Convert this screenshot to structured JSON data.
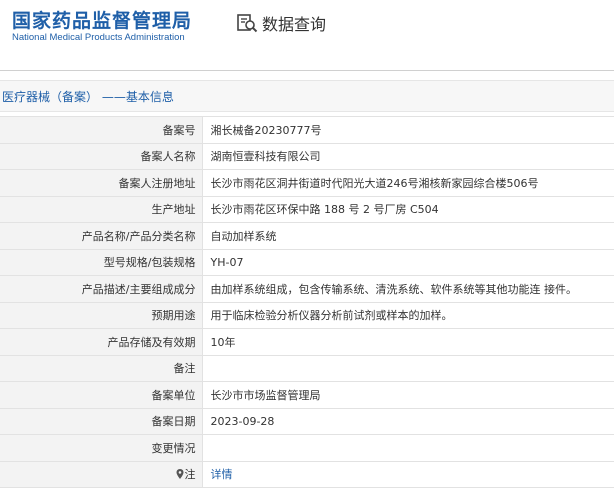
{
  "header": {
    "logo_cn": "国家药品监督管理局",
    "logo_en": "National Medical Products Administration",
    "query_label": "数据查询"
  },
  "breadcrumb": {
    "text": "医疗器械（备案） ——基本信息"
  },
  "rows": [
    {
      "label": "备案号",
      "value": "湘长械备20230777号"
    },
    {
      "label": "备案人名称",
      "value": "湖南恒壹科技有限公司"
    },
    {
      "label": "备案人注册地址",
      "value": "长沙市雨花区洞井街道时代阳光大道246号湘核新家园综合楼506号"
    },
    {
      "label": "生产地址",
      "value": "长沙市雨花区环保中路 188 号 2 号厂房 C504"
    },
    {
      "label": "产品名称/产品分类名称",
      "value": "自动加样系统"
    },
    {
      "label": "型号规格/包装规格",
      "value": "YH-07"
    },
    {
      "label": "产品描述/主要组成成分",
      "value": "由加样系统组成，包含传输系统、清洗系统、软件系统等其他功能连 接件。"
    },
    {
      "label": "预期用途",
      "value": "用于临床检验分析仪器分析前试剂或样本的加样。"
    },
    {
      "label": "产品存储及有效期",
      "value": "10年"
    },
    {
      "label": "备注",
      "value": ""
    },
    {
      "label": "备案单位",
      "value": "长沙市市场监督管理局"
    },
    {
      "label": "备案日期",
      "value": "2023-09-28"
    },
    {
      "label": "变更情况",
      "value": ""
    }
  ],
  "footer_row": {
    "label": "注",
    "link": "详情"
  },
  "colors": {
    "brand_blue": "#1f5fa8",
    "label_bg": "#f3f3f3",
    "border": "#e2e2e2"
  }
}
